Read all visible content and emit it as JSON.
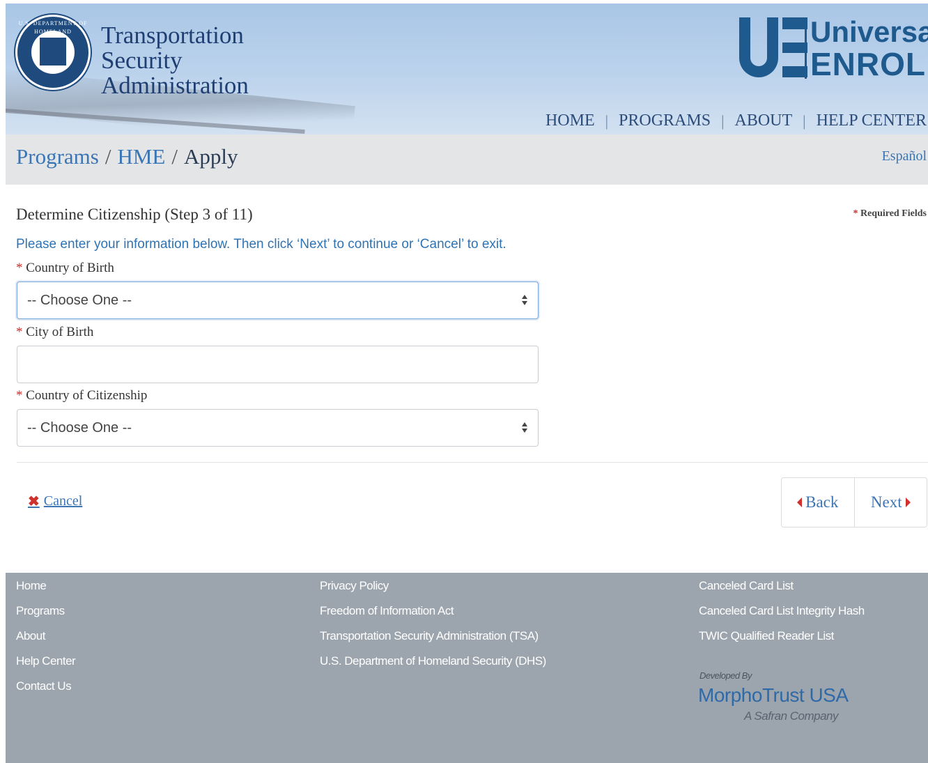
{
  "header": {
    "seal_text": "U.S. DEPARTMENT OF HOMELAND SECURITY",
    "agency_line1": "Transportation",
    "agency_line2": "Security",
    "agency_line3": "Administration",
    "brand_universal": "Universal",
    "brand_enroll": "ENROLL",
    "nav": [
      "HOME",
      "PROGRAMS",
      "ABOUT",
      "HELP CENTER"
    ]
  },
  "breadcrumb": {
    "items": [
      "Programs",
      "HME",
      "Apply"
    ],
    "separator": "/",
    "language_link": "Español"
  },
  "form": {
    "step_title": "Determine Citizenship (Step 3 of 11)",
    "required_star": "*",
    "required_note": "Required Fields",
    "instructions": "Please enter your information below. Then click ‘Next’ to continue or ‘Cancel’ to exit.",
    "fields": [
      {
        "label": "Country of Birth",
        "value": "-- Choose One --"
      },
      {
        "label": "City of Birth",
        "value": ""
      },
      {
        "label": "Country of Citizenship",
        "value": "-- Choose One --"
      }
    ],
    "cancel_label": "Cancel",
    "back_label": "Back",
    "next_label": "Next"
  },
  "footer": {
    "col1": [
      "Home",
      "Programs",
      "About",
      "Help Center",
      "Contact Us"
    ],
    "col2": [
      "Privacy Policy",
      "Freedom of Information Act",
      "Transportation Security Administration (TSA)",
      "U.S. Department of Homeland Security (DHS)"
    ],
    "col3": [
      "Canceled Card List",
      "Canceled Card List Integrity Hash",
      "TWIC Qualified Reader List"
    ],
    "developed_by": "Developed By",
    "developer": "MorphoTrust USA",
    "developer_tagline": "A Safran Company"
  },
  "colors": {
    "link_blue": "#3b75b4",
    "brand_blue": "#1e5a8e",
    "required_red": "#c9302c",
    "footer_gray": "#9ca5ad"
  }
}
